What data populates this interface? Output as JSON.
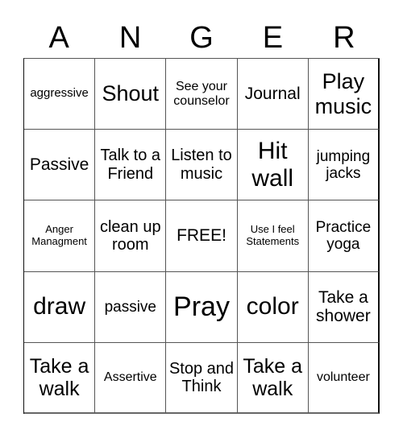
{
  "header": {
    "letters": [
      "A",
      "N",
      "G",
      "E",
      "R"
    ]
  },
  "grid": {
    "rows": [
      [
        "aggressive",
        "Shout",
        "See your counselor",
        "Journal",
        "Play music"
      ],
      [
        "Passive",
        "Talk to a Friend",
        "Listen to music",
        "Hit wall",
        "jumping jacks"
      ],
      [
        "Anger Managment",
        "clean up room",
        "FREE!",
        "Use I feel Statements",
        "Practice yoga"
      ],
      [
        "draw",
        "passive",
        "Pray",
        "color",
        "Take a shower"
      ],
      [
        "Take a walk",
        "Assertive",
        "Stop and Think",
        "Take a walk",
        "volunteer"
      ]
    ]
  }
}
